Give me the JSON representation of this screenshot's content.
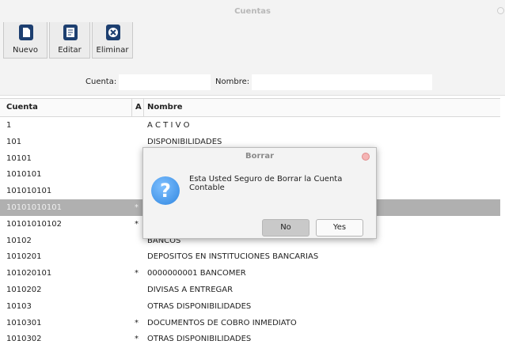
{
  "window": {
    "title": "Cuentas"
  },
  "toolbar": {
    "buttons": [
      {
        "label": "Nuevo",
        "icon": "new-document-icon"
      },
      {
        "label": "Editar",
        "icon": "edit-document-icon"
      },
      {
        "label": "Eliminar",
        "icon": "delete-x-icon"
      }
    ]
  },
  "filter": {
    "cuenta_label": "Cuenta:",
    "cuenta_value": "",
    "nombre_label": "Nombre:",
    "nombre_value": ""
  },
  "table": {
    "headers": {
      "cuenta": "Cuenta",
      "a": "A",
      "nombre": "Nombre"
    },
    "rows": [
      {
        "cuenta": "1",
        "a": "",
        "nombre": "A C T I V O",
        "selected": false
      },
      {
        "cuenta": "101",
        "a": "",
        "nombre": "DISPONIBILIDADES",
        "selected": false
      },
      {
        "cuenta": "10101",
        "a": "",
        "nombre": "CAJA",
        "selected": false
      },
      {
        "cuenta": "1010101",
        "a": "",
        "nombre": "",
        "selected": false
      },
      {
        "cuenta": "101010101",
        "a": "",
        "nombre": "",
        "selected": false
      },
      {
        "cuenta": "10101010101",
        "a": "*",
        "nombre": "",
        "selected": true
      },
      {
        "cuenta": "10101010102",
        "a": "*",
        "nombre": "",
        "selected": false
      },
      {
        "cuenta": "10102",
        "a": "",
        "nombre": "BANCOS",
        "selected": false
      },
      {
        "cuenta": "1010201",
        "a": "",
        "nombre": "DEPOSITOS EN INSTITUCIONES BANCARIAS",
        "selected": false
      },
      {
        "cuenta": "101020101",
        "a": "*",
        "nombre": "0000000001 BANCOMER",
        "selected": false
      },
      {
        "cuenta": "1010202",
        "a": "",
        "nombre": "DIVISAS A ENTREGAR",
        "selected": false
      },
      {
        "cuenta": "10103",
        "a": "",
        "nombre": "OTRAS DISPONIBILIDADES",
        "selected": false
      },
      {
        "cuenta": "1010301",
        "a": "*",
        "nombre": "DOCUMENTOS DE COBRO INMEDIATO",
        "selected": false
      },
      {
        "cuenta": "1010302",
        "a": "*",
        "nombre": "OTRAS DISPONIBILIDADES",
        "selected": false
      }
    ]
  },
  "dialog": {
    "title": "Borrar",
    "icon": "question-icon",
    "message": "Esta Usted Seguro de Borrar la Cuenta Contable",
    "no_label": "No",
    "yes_label": "Yes"
  }
}
